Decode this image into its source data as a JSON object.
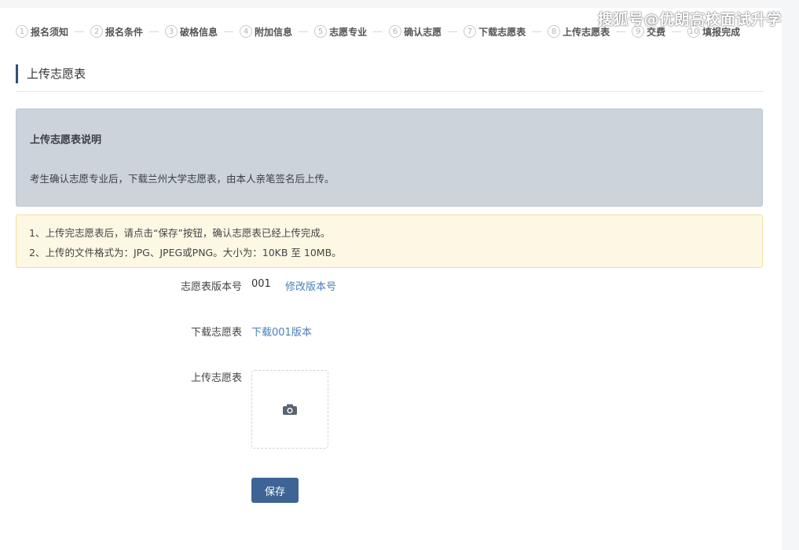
{
  "watermark": "搜狐号@优朗高校面试升学",
  "steps": [
    {
      "num": "1",
      "label": "报名须知"
    },
    {
      "num": "2",
      "label": "报名条件"
    },
    {
      "num": "3",
      "label": "破格信息"
    },
    {
      "num": "4",
      "label": "附加信息"
    },
    {
      "num": "5",
      "label": "志愿专业"
    },
    {
      "num": "6",
      "label": "确认志愿"
    },
    {
      "num": "7",
      "label": "下载志愿表"
    },
    {
      "num": "8",
      "label": "上传志愿表"
    },
    {
      "num": "9",
      "label": "交费"
    },
    {
      "num": "10",
      "label": "填报完成"
    }
  ],
  "section_title": "上传志愿表",
  "info": {
    "title": "上传志愿表说明",
    "text": "考生确认志愿专业后，下载兰州大学志愿表，由本人亲笔签名后上传。"
  },
  "notice": [
    "1、上传完志愿表后，请点击“保存”按钮，确认志愿表已经上传完成。",
    "2、上传的文件格式为：JPG、JPEG或PNG。大小为：10KB 至 10MB。"
  ],
  "form": {
    "version_label": "志愿表版本号",
    "version_value": "001",
    "modify_link": "修改版本号",
    "download_label": "下载志愿表",
    "download_link": "下载001版本",
    "upload_label": "上传志愿表"
  },
  "save_label": "保存",
  "colors": {
    "accent": "#3e6496",
    "link": "#4a7ebb",
    "info_bg": "#cdd3db",
    "notice_bg": "#fdf8e4"
  },
  "icons": {
    "upload": "camera-icon"
  }
}
